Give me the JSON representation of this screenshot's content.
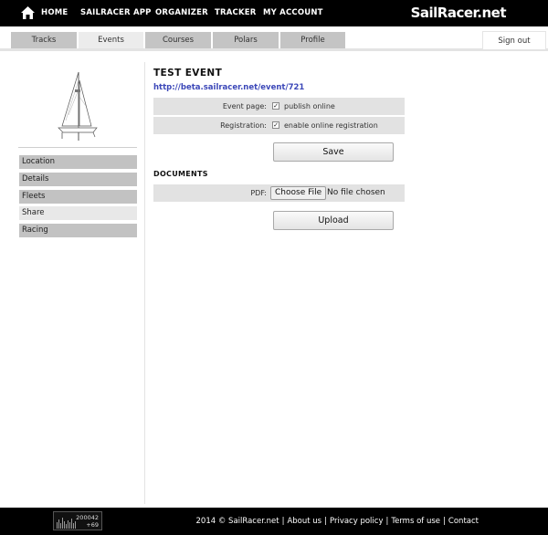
{
  "nav": {
    "home": "HOME",
    "items": [
      "SAILRACER APP",
      "ORGANIZER",
      "TRACKER",
      "MY ACCOUNT"
    ],
    "logo": "SailRacer.net"
  },
  "tabs": {
    "items": [
      "Tracks",
      "Events",
      "Courses",
      "Polars",
      "Profile"
    ],
    "active": "Events",
    "sign_out": "Sign out"
  },
  "sidebar": {
    "items": [
      "Location",
      "Details",
      "Fleets",
      "Share",
      "Racing"
    ],
    "active": "Share"
  },
  "event": {
    "title": "TEST EVENT",
    "url": "http://beta.sailracer.net/event/721",
    "event_page_label": "Event page:",
    "event_page_option": "publish online",
    "event_page_checked": true,
    "registration_label": "Registration:",
    "registration_option": "enable online registration",
    "registration_checked": true,
    "save_label": "Save"
  },
  "documents": {
    "heading": "DOCUMENTS",
    "pdf_label": "PDF:",
    "choose_file": "Choose File",
    "file_status": "No file chosen",
    "upload_label": "Upload"
  },
  "footer": {
    "counter_value": "200042",
    "counter_delta": "+69",
    "copyright": "2014 © SailRacer.net",
    "links": [
      "About us",
      "Privacy policy",
      "Terms of use",
      "Contact"
    ]
  },
  "colors": {
    "header_bg": "#000000",
    "tab_bg": "#c4c4c4",
    "tab_active_bg": "#ececec",
    "sidebar_item_bg": "#c2c2c2",
    "form_row_bg": "#e2e2e2",
    "link": "#3b47b8"
  }
}
